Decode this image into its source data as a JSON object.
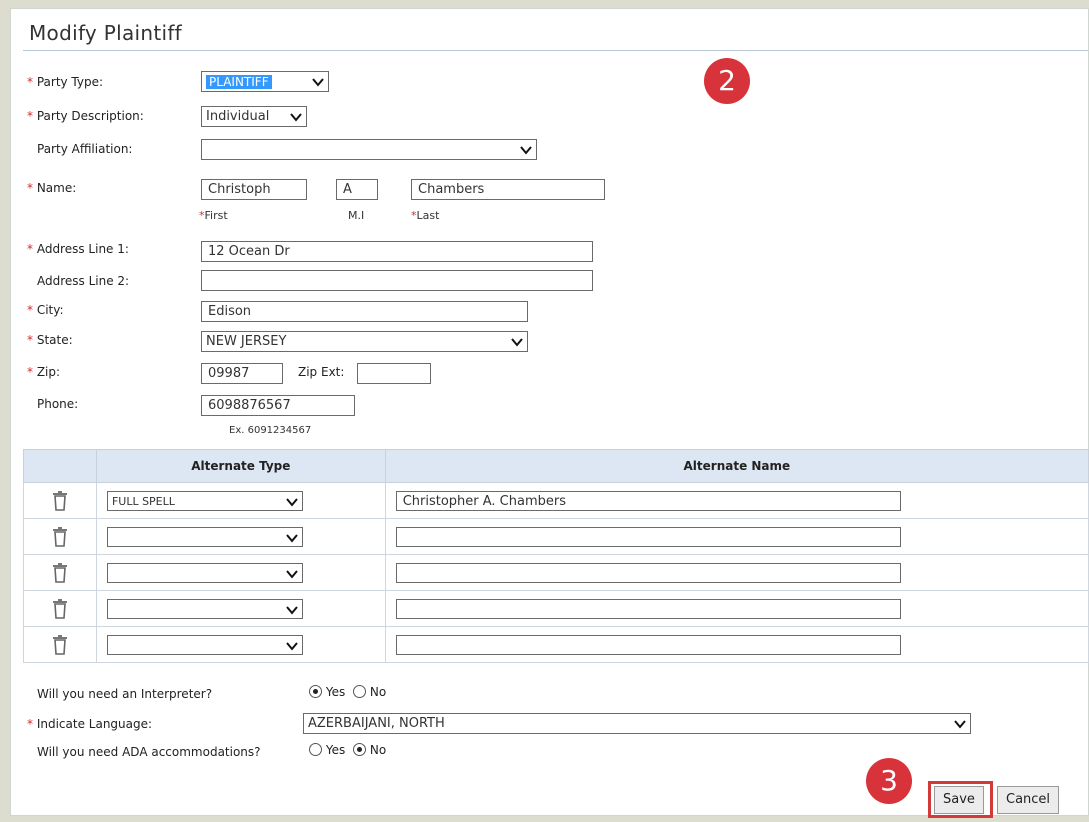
{
  "page": {
    "title": "Modify Plaintiff"
  },
  "form": {
    "party_type": {
      "label": "Party Type:",
      "required": "*",
      "value": "PLAINTIFF"
    },
    "party_description": {
      "label": "Party Description:",
      "required": "*",
      "value": "Individual"
    },
    "party_affiliation": {
      "label": "Party Affiliation:",
      "value": ""
    },
    "name": {
      "label": "Name:",
      "required": "*",
      "first": "Christoph",
      "mi": "A",
      "last": "Chambers",
      "first_caption": "First",
      "mi_caption": "M.I",
      "last_caption": "Last"
    },
    "address1": {
      "label": "Address Line 1:",
      "required": "*",
      "value": "12 Ocean Dr"
    },
    "address2": {
      "label": "Address Line 2:",
      "value": ""
    },
    "city": {
      "label": "City:",
      "required": "*",
      "value": "Edison"
    },
    "state": {
      "label": "State:",
      "required": "*",
      "value": "NEW JERSEY"
    },
    "zip": {
      "label": "Zip:",
      "required": "*",
      "value": "09987",
      "ext_label": "Zip Ext:",
      "ext_value": ""
    },
    "phone": {
      "label": "Phone:",
      "value": "6098876567",
      "hint": "Ex. 6091234567"
    }
  },
  "alternates": {
    "col_type": "Alternate Type",
    "col_name": "Alternate Name",
    "rows": [
      {
        "type": "FULL SPELL",
        "name": "Christopher A. Chambers"
      },
      {
        "type": "",
        "name": ""
      },
      {
        "type": "",
        "name": ""
      },
      {
        "type": "",
        "name": ""
      },
      {
        "type": "",
        "name": ""
      }
    ]
  },
  "interpreter": {
    "question": "Will you need an Interpreter?",
    "yes": "Yes",
    "no": "No",
    "selected": "Yes"
  },
  "language": {
    "label": "Indicate Language:",
    "required": "*",
    "value": "AZERBAIJANI, NORTH"
  },
  "ada": {
    "question": "Will you need ADA accommodations?",
    "yes": "Yes",
    "no": "No",
    "selected": "No"
  },
  "buttons": {
    "save": "Save",
    "cancel": "Cancel"
  },
  "annotations": {
    "step2": "2",
    "step3": "3",
    "badge_color": "#d8333a"
  }
}
